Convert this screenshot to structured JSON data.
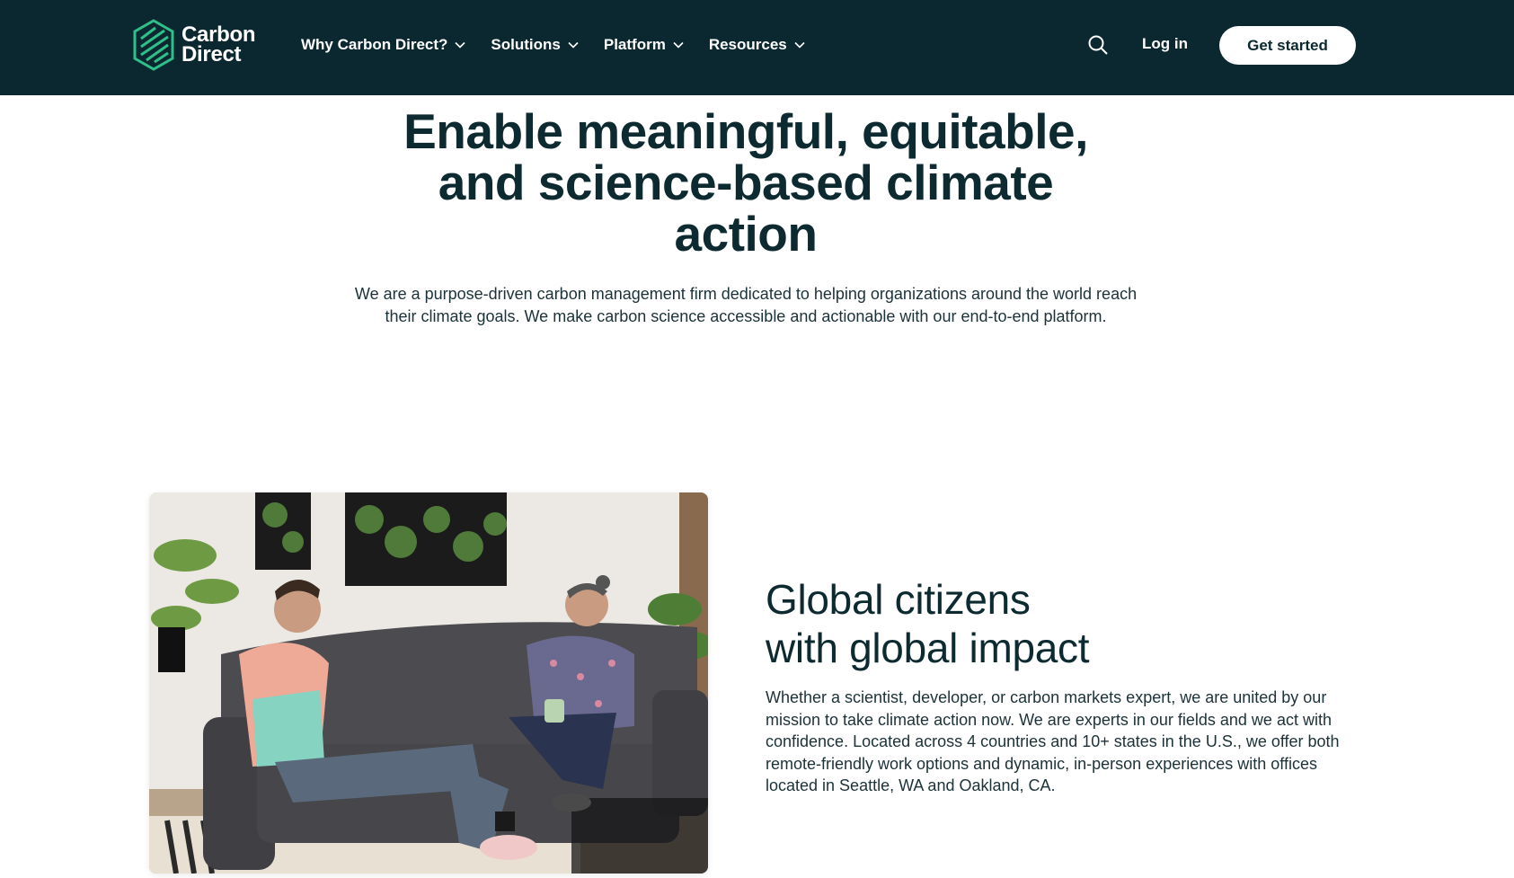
{
  "header": {
    "logo": {
      "line1": "Carbon",
      "line2": "Direct"
    },
    "nav": [
      {
        "label": "Why Carbon Direct?"
      },
      {
        "label": "Solutions"
      },
      {
        "label": "Platform"
      },
      {
        "label": "Resources"
      }
    ],
    "login_label": "Log in",
    "cta_label": "Get started"
  },
  "hero": {
    "title_line1": "Enable meaningful, equitable,",
    "title_line2": "and science-based climate",
    "title_line3": "action",
    "subtitle": "We are a purpose-driven carbon management firm dedicated to helping organizations around the world reach their climate goals. We make carbon science accessible and actionable with our end-to-end platform."
  },
  "feature": {
    "title_line1": "Global citizens",
    "title_line2": "with global impact",
    "body": "Whether a scientist, developer, or carbon markets expert, we are united by our mission to take climate action now. We are experts in our fields and we act with confidence. Located across 4 countries and 10+ states in the U.S., we offer both remote-friendly work options and dynamic, in-person experiences with offices located in Seattle, WA and Oakland, CA."
  },
  "colors": {
    "header_bg": "#0b2830",
    "logo_green": "#2fc08a",
    "text_dark": "#0d2a30"
  },
  "icons": [
    "carbon-direct-logo-icon",
    "chevron-down-icon",
    "search-icon"
  ]
}
